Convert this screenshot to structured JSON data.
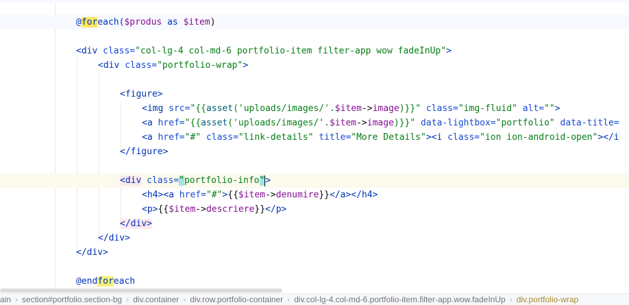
{
  "editor": {
    "lines": {
      "l01_part1": "@",
      "l01_find": "for",
      "l01_part2": "each(",
      "l01_var1": "$produs",
      "l01_as": " as ",
      "l01_var2": "$item",
      "l01_close": ")",
      "l02_open": "<div ",
      "l02_attr": "class=",
      "l02_val": "\"col-lg-4 col-md-6 portfolio-item filter-app wow fadeInUp\"",
      "l02_close": ">",
      "l03_open": "<div ",
      "l03_attr": "class=",
      "l03_val": "\"portfolio-wrap\"",
      "l03_close": ">",
      "l04": "<figure>",
      "l05_open": "<img ",
      "l05_attr1": "src=",
      "l05_q": "\"{{",
      "l05_fn": "asset",
      "l05_arg": "('uploads/images/'.",
      "l05_var": "$item",
      "l05_arrow": "->",
      "l05_prop": "image",
      "l05_end": ")}}\" ",
      "l05_attr2": "class=",
      "l05_val2": "\"img-fluid\" ",
      "l05_attr3": "alt=",
      "l05_val3": "\"\"",
      "l05_close": ">",
      "l06_open": "<a ",
      "l06_attr1": "href=",
      "l06_q": "\"{{",
      "l06_fn": "asset",
      "l06_arg": "('uploads/images/'.",
      "l06_var": "$item",
      "l06_arrow": "->",
      "l06_prop": "image",
      "l06_end": ")}}\" ",
      "l06_attr2": "data-lightbox=",
      "l06_val2": "\"portfolio\" ",
      "l06_attr3": "data-title=",
      "l07_open": "<a ",
      "l07_attr1": "href=",
      "l07_val1": "\"#\" ",
      "l07_attr2": "class=",
      "l07_val2": "\"link-details\" ",
      "l07_attr3": "title=",
      "l07_val3": "\"More Details\"",
      "l07_mid": "><i ",
      "l07_attr4": "class=",
      "l07_val4": "\"ion ion-android-open\"",
      "l07_tail": "></i",
      "l08": "</figure>",
      "l09_open": "<div",
      "l09_sp": " ",
      "l09_attr": "class=",
      "l09_q1": "\"",
      "l09_val": "portfolio-info",
      "l09_q2": "\"",
      "l09_close": ">",
      "l10_open": "<h4><a ",
      "l10_attr": "href=",
      "l10_val": "\"#\"",
      "l10_gt": ">",
      "l10_b1": "{{",
      "l10_var": "$item",
      "l10_arrow": "->",
      "l10_prop": "denumire",
      "l10_b2": "}}",
      "l10_close": "</a></h4>",
      "l11_open": "<p>",
      "l11_b1": "{{",
      "l11_var": "$item",
      "l11_arrow": "->",
      "l11_prop": "descriere",
      "l11_b2": "}}",
      "l11_close": "</p>",
      "l12": "</div>",
      "l13": "</div>",
      "l14": "</div>",
      "l15_part1": "@end",
      "l15_find": "for",
      "l15_part2": "each"
    }
  },
  "breadcrumb": [
    "ain",
    "section#portfolio.section-bg",
    "div.container",
    "div.row.portfolio-container",
    "div.col-lg-4.col-md-6.portfolio-item.filter-app.wow.fadeInUp",
    "div.portfolio-wrap"
  ],
  "breadcrumb_separator": "›",
  "colors": {
    "tag": "#0033b3",
    "string": "#067d17",
    "variable": "#871094",
    "function": "#00627a",
    "search_match": "#f7f07a",
    "brace_match": "#9fe5e1"
  }
}
